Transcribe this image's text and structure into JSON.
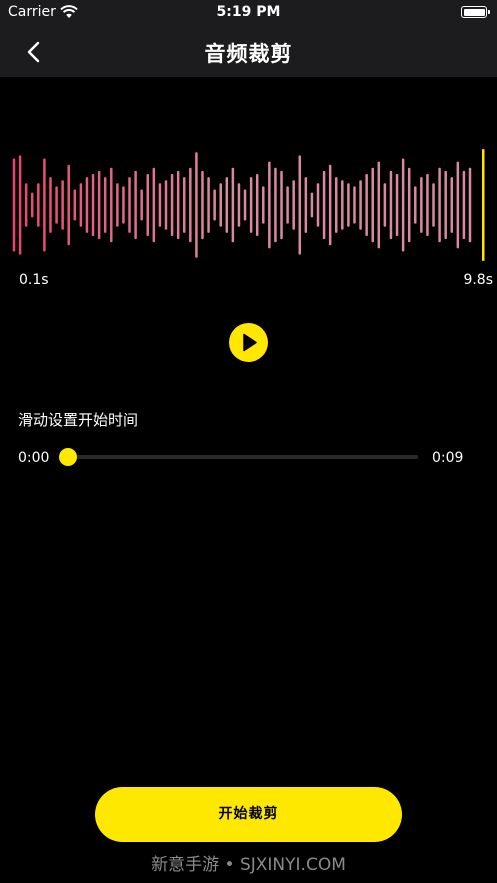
{
  "status_bar": {
    "carrier": "Carrier",
    "time": "5:19 PM",
    "icons": [
      "wifi-icon",
      "battery-icon"
    ]
  },
  "nav": {
    "title": "音频裁剪",
    "back_icon": "chevron-left-icon"
  },
  "waveform": {
    "start_label": "0.1s",
    "end_label": "9.8s",
    "colors": {
      "bar_start": "#e8466f",
      "bar_end": "#d98aa0",
      "end_marker": "#ffe800"
    },
    "bar_levels": [
      0.75,
      0.8,
      0.35,
      0.2,
      0.35,
      0.75,
      0.45,
      0.3,
      0.4,
      0.65,
      0.25,
      0.35,
      0.45,
      0.5,
      0.55,
      0.45,
      0.6,
      0.35,
      0.3,
      0.45,
      0.55,
      0.25,
      0.5,
      0.6,
      0.35,
      0.4,
      0.5,
      0.55,
      0.45,
      0.6,
      0.85,
      0.55,
      0.45,
      0.25,
      0.35,
      0.45,
      0.6,
      0.35,
      0.25,
      0.45,
      0.5,
      0.3,
      0.7,
      0.6,
      0.55,
      0.3,
      0.4,
      0.8,
      0.45,
      0.2,
      0.35,
      0.55,
      0.65,
      0.45,
      0.4,
      0.35,
      0.3,
      0.4,
      0.5,
      0.6,
      0.7,
      0.35,
      0.55,
      0.5,
      0.75,
      0.6,
      0.3,
      0.45,
      0.5,
      0.35,
      0.6,
      0.55,
      0.45,
      0.7,
      0.55,
      0.6
    ],
    "end_marker_level": 0.9
  },
  "player": {
    "play_icon": "play-icon"
  },
  "slider": {
    "title": "滑动设置开始时间",
    "min_label": "0:00",
    "max_label": "0:09",
    "value": 0
  },
  "actions": {
    "start_label": "开始裁剪"
  },
  "watermark": "新意手游 • SJXINYI.COM",
  "accent_color": "#ffe800"
}
